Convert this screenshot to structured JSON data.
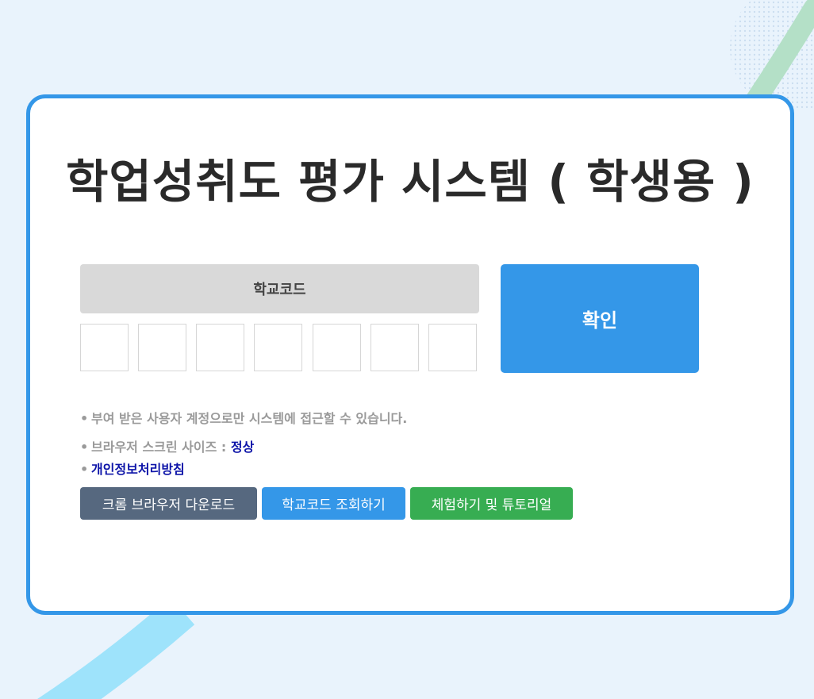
{
  "title": "학업성취도 평가 시스템 ( 학생용 )",
  "school_code": {
    "header_label": "학교코드",
    "digits": [
      "",
      "",
      "",
      "",
      "",
      "",
      ""
    ]
  },
  "confirm_label": "확인",
  "notes": {
    "bullet": "•",
    "account_notice": "부여 받은 사용자 계정으로만 시스템에 접근할 수 있습니다.",
    "screen_size_label": "브라우저 스크린 사이즈 : ",
    "screen_size_status": "정상",
    "privacy_policy": "개인정보처리방침"
  },
  "buttons": {
    "chrome_download": "크롬 브라우저 다운로드",
    "school_code_lookup": "학교코드 조회하기",
    "trial_tutorial": "체험하기 및 튜토리얼"
  },
  "colors": {
    "accent": "#3497e8",
    "chrome_button": "#56687f",
    "trial_button": "#37ad52",
    "status_ok": "#0d14a8",
    "background": "#e9f3fc"
  }
}
